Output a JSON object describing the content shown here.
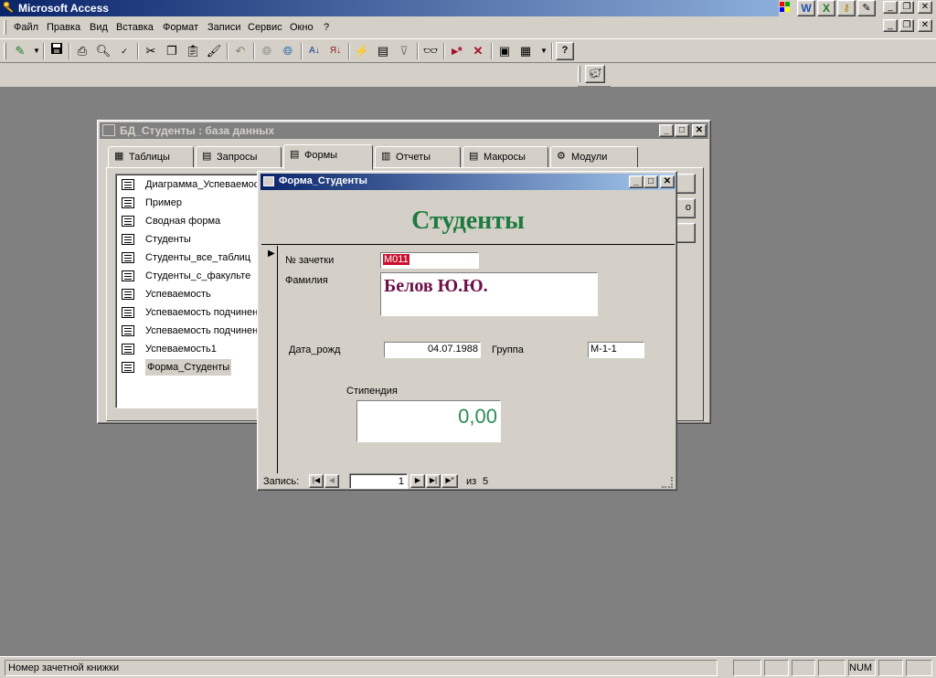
{
  "app": {
    "title": "Microsoft Access"
  },
  "menu": [
    "Файл",
    "Правка",
    "Вид",
    "Вставка",
    "Формат",
    "Записи",
    "Сервис",
    "Окно",
    "?"
  ],
  "db_window": {
    "title": "БД_Студенты : база данных",
    "tabs": [
      "Таблицы",
      "Запросы",
      "Формы",
      "Отчеты",
      "Макросы",
      "Модули"
    ],
    "active_tab": "Формы",
    "items": [
      "Диаграмма_Успеваемос",
      "Пример",
      "Сводная форма",
      "Студенты",
      "Студенты_все_таблиц",
      "Студенты_с_факульте",
      "Успеваемость",
      "Успеваемость подчинен",
      "Успеваемость подчинен",
      "Успеваемость1",
      "Форма_Студенты"
    ],
    "selected_item": "Форма_Студенты",
    "button_partial": "о"
  },
  "form": {
    "title": "Форма_Студенты",
    "header": "Студенты",
    "fields": {
      "zachetka_label": "№ зачетки",
      "zachetka_value": "M011",
      "familiya_label": "Фамилия",
      "familiya_value": "Белов Ю.Ю.",
      "data_label": "Дата_рожд",
      "data_value": "04.07.1988",
      "gruppa_label": "Группа",
      "gruppa_value": "М-1-1",
      "stipendia_label": "Стипендия",
      "stipendia_value": "0,00"
    },
    "nav": {
      "label": "Запись:",
      "current": "1",
      "of_label": "из",
      "total": "5"
    }
  },
  "status": {
    "text": "Номер зачетной книжки",
    "num": "NUM"
  },
  "colors": {
    "header_green": "#1f7a3f",
    "name_maroon": "#6b1048",
    "stipend_green": "#2e8b57"
  }
}
